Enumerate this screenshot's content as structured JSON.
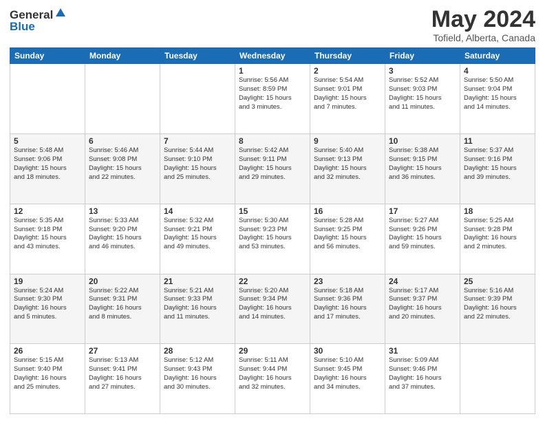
{
  "logo": {
    "general": "General",
    "blue": "Blue"
  },
  "header": {
    "month_year": "May 2024",
    "location": "Tofield, Alberta, Canada"
  },
  "days_of_week": [
    "Sunday",
    "Monday",
    "Tuesday",
    "Wednesday",
    "Thursday",
    "Friday",
    "Saturday"
  ],
  "weeks": [
    [
      {
        "day": "",
        "info": ""
      },
      {
        "day": "",
        "info": ""
      },
      {
        "day": "",
        "info": ""
      },
      {
        "day": "1",
        "info": "Sunrise: 5:56 AM\nSunset: 8:59 PM\nDaylight: 15 hours\nand 3 minutes."
      },
      {
        "day": "2",
        "info": "Sunrise: 5:54 AM\nSunset: 9:01 PM\nDaylight: 15 hours\nand 7 minutes."
      },
      {
        "day": "3",
        "info": "Sunrise: 5:52 AM\nSunset: 9:03 PM\nDaylight: 15 hours\nand 11 minutes."
      },
      {
        "day": "4",
        "info": "Sunrise: 5:50 AM\nSunset: 9:04 PM\nDaylight: 15 hours\nand 14 minutes."
      }
    ],
    [
      {
        "day": "5",
        "info": "Sunrise: 5:48 AM\nSunset: 9:06 PM\nDaylight: 15 hours\nand 18 minutes."
      },
      {
        "day": "6",
        "info": "Sunrise: 5:46 AM\nSunset: 9:08 PM\nDaylight: 15 hours\nand 22 minutes."
      },
      {
        "day": "7",
        "info": "Sunrise: 5:44 AM\nSunset: 9:10 PM\nDaylight: 15 hours\nand 25 minutes."
      },
      {
        "day": "8",
        "info": "Sunrise: 5:42 AM\nSunset: 9:11 PM\nDaylight: 15 hours\nand 29 minutes."
      },
      {
        "day": "9",
        "info": "Sunrise: 5:40 AM\nSunset: 9:13 PM\nDaylight: 15 hours\nand 32 minutes."
      },
      {
        "day": "10",
        "info": "Sunrise: 5:38 AM\nSunset: 9:15 PM\nDaylight: 15 hours\nand 36 minutes."
      },
      {
        "day": "11",
        "info": "Sunrise: 5:37 AM\nSunset: 9:16 PM\nDaylight: 15 hours\nand 39 minutes."
      }
    ],
    [
      {
        "day": "12",
        "info": "Sunrise: 5:35 AM\nSunset: 9:18 PM\nDaylight: 15 hours\nand 43 minutes."
      },
      {
        "day": "13",
        "info": "Sunrise: 5:33 AM\nSunset: 9:20 PM\nDaylight: 15 hours\nand 46 minutes."
      },
      {
        "day": "14",
        "info": "Sunrise: 5:32 AM\nSunset: 9:21 PM\nDaylight: 15 hours\nand 49 minutes."
      },
      {
        "day": "15",
        "info": "Sunrise: 5:30 AM\nSunset: 9:23 PM\nDaylight: 15 hours\nand 53 minutes."
      },
      {
        "day": "16",
        "info": "Sunrise: 5:28 AM\nSunset: 9:25 PM\nDaylight: 15 hours\nand 56 minutes."
      },
      {
        "day": "17",
        "info": "Sunrise: 5:27 AM\nSunset: 9:26 PM\nDaylight: 15 hours\nand 59 minutes."
      },
      {
        "day": "18",
        "info": "Sunrise: 5:25 AM\nSunset: 9:28 PM\nDaylight: 16 hours\nand 2 minutes."
      }
    ],
    [
      {
        "day": "19",
        "info": "Sunrise: 5:24 AM\nSunset: 9:30 PM\nDaylight: 16 hours\nand 5 minutes."
      },
      {
        "day": "20",
        "info": "Sunrise: 5:22 AM\nSunset: 9:31 PM\nDaylight: 16 hours\nand 8 minutes."
      },
      {
        "day": "21",
        "info": "Sunrise: 5:21 AM\nSunset: 9:33 PM\nDaylight: 16 hours\nand 11 minutes."
      },
      {
        "day": "22",
        "info": "Sunrise: 5:20 AM\nSunset: 9:34 PM\nDaylight: 16 hours\nand 14 minutes."
      },
      {
        "day": "23",
        "info": "Sunrise: 5:18 AM\nSunset: 9:36 PM\nDaylight: 16 hours\nand 17 minutes."
      },
      {
        "day": "24",
        "info": "Sunrise: 5:17 AM\nSunset: 9:37 PM\nDaylight: 16 hours\nand 20 minutes."
      },
      {
        "day": "25",
        "info": "Sunrise: 5:16 AM\nSunset: 9:39 PM\nDaylight: 16 hours\nand 22 minutes."
      }
    ],
    [
      {
        "day": "26",
        "info": "Sunrise: 5:15 AM\nSunset: 9:40 PM\nDaylight: 16 hours\nand 25 minutes."
      },
      {
        "day": "27",
        "info": "Sunrise: 5:13 AM\nSunset: 9:41 PM\nDaylight: 16 hours\nand 27 minutes."
      },
      {
        "day": "28",
        "info": "Sunrise: 5:12 AM\nSunset: 9:43 PM\nDaylight: 16 hours\nand 30 minutes."
      },
      {
        "day": "29",
        "info": "Sunrise: 5:11 AM\nSunset: 9:44 PM\nDaylight: 16 hours\nand 32 minutes."
      },
      {
        "day": "30",
        "info": "Sunrise: 5:10 AM\nSunset: 9:45 PM\nDaylight: 16 hours\nand 34 minutes."
      },
      {
        "day": "31",
        "info": "Sunrise: 5:09 AM\nSunset: 9:46 PM\nDaylight: 16 hours\nand 37 minutes."
      },
      {
        "day": "",
        "info": ""
      }
    ]
  ]
}
